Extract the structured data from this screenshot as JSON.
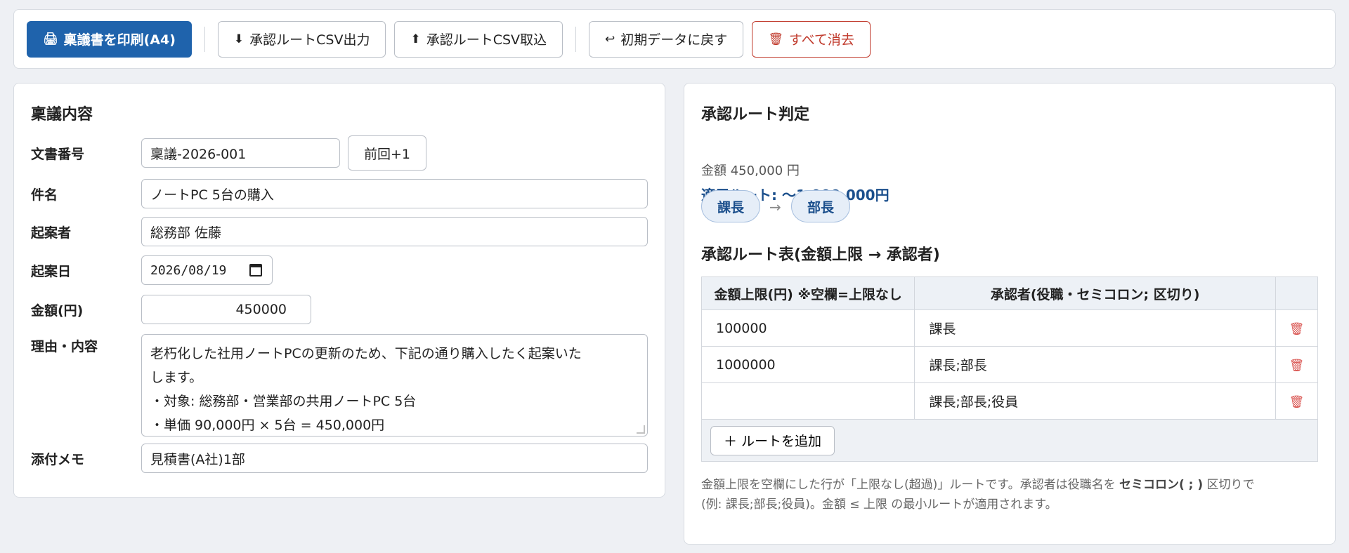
{
  "toolbar": {
    "print_label": "稟議書を印刷(A4)",
    "export_label": "承認ルートCSV出力",
    "import_label": "承認ルートCSV取込",
    "reset_label": "初期データに戻す",
    "clear_label": "すべて消去"
  },
  "form": {
    "title": "稟議内容",
    "doc_number": {
      "label": "文書番号",
      "value": "稟議-2026-001",
      "increment_label": "前回+1"
    },
    "subject": {
      "label": "件名",
      "value": "ノートPC 5台の購入"
    },
    "author": {
      "label": "起案者",
      "value": "総務部 佐藤"
    },
    "date": {
      "label": "起案日",
      "value": "2026/08/19"
    },
    "amount": {
      "label": "金額(円)",
      "value": "450000"
    },
    "reason": {
      "label": "理由・内容",
      "lines": [
        "老朽化した社用ノートPCの更新のため、下記の通り購入したく起案いた",
        "します。",
        "・対象: 総務部・営業部の共用ノートPC 5台",
        "・単価 90,000円 × 5台 = 450,000円"
      ]
    },
    "attachment": {
      "label": "添付メモ",
      "value": "見積書(A社)1部"
    }
  },
  "routing": {
    "title": "承認ルート判定",
    "amount_text": "金額 450,000 円",
    "applied_text": "適用ルート: 〜1,000,000円",
    "chips": [
      "課長",
      "部長"
    ],
    "arrow": "→",
    "table_title": "承認ルート表(金額上限 → 承認者)",
    "table": {
      "headers": [
        "金額上限(円) ※空欄=上限なし",
        "承認者(役職・セミコロン; 区切り)",
        ""
      ],
      "rows": [
        {
          "limit": "100000",
          "approvers": "課長"
        },
        {
          "limit": "1000000",
          "approvers": "課長;部長"
        },
        {
          "limit": "",
          "approvers": "課長;部長;役員"
        }
      ]
    },
    "add_label": "＋ ルートを追加",
    "note_part1": "金額上限を空欄にした行が「上限なし(超過)」ルートです。承認者は役職名を ",
    "note_bold": "セミコロン( ; )",
    "note_part2": " 区切りで",
    "note_line2": "(例: 課長;部長;役員)。金額 ≤ 上限 の最小ルートが適用されます。"
  }
}
